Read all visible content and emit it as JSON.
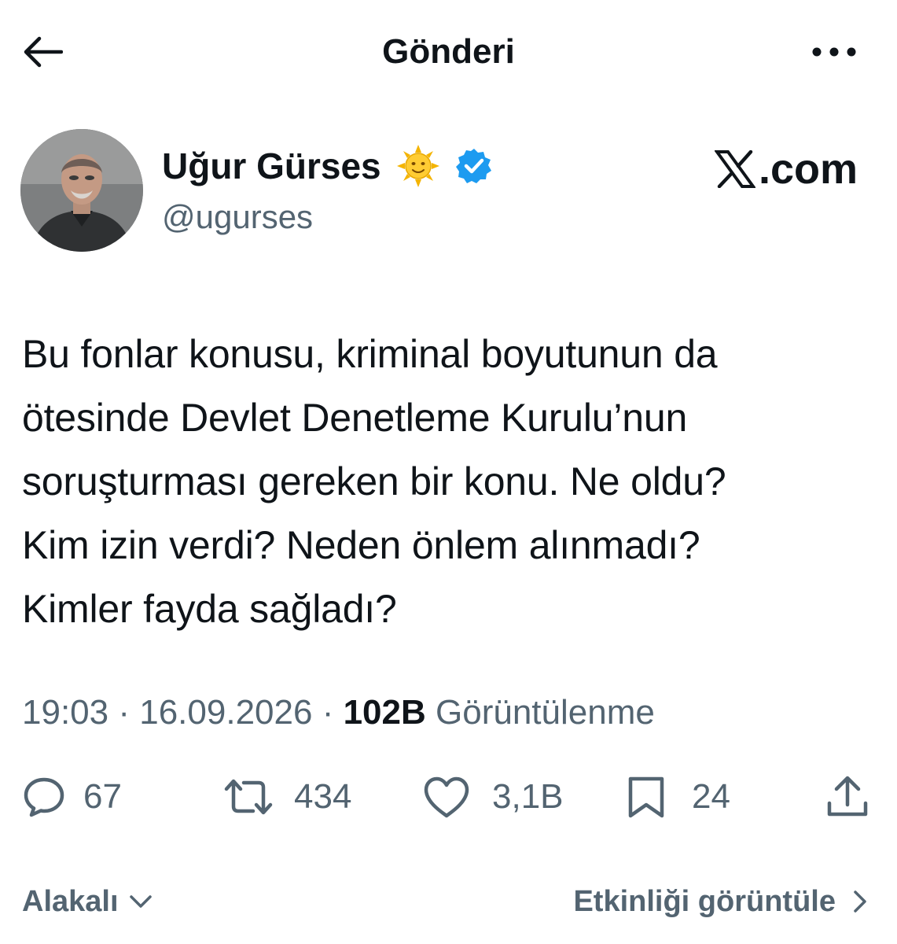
{
  "header": {
    "title": "Gönderi",
    "back_icon": "arrow-left-icon",
    "more_icon": "more-horizontal-icon"
  },
  "author": {
    "name": "Uğur Gürses",
    "handle": "@ugurses",
    "emoji": "sun-with-face-icon",
    "verified_icon": "verified-badge-icon",
    "verified_color": "#1d9bf0"
  },
  "brand": {
    "label": ".com",
    "icon": "x-logo-icon"
  },
  "post": {
    "text": "Bu fonlar konusu, kriminal boyutunun da\nötesinde Devlet Denetleme Kurulu’nun\nsoruşturması gereken bir konu. Ne oldu?\nKim izin verdi? Neden önlem alınmadı?\nKimler fayda sağladı?",
    "time": "19:03",
    "date": "16.09.2026",
    "separator": "·",
    "views_count": "102B",
    "views_label": "Görüntülenme"
  },
  "actions": {
    "replies": {
      "icon": "reply-icon",
      "count": "67"
    },
    "reposts": {
      "icon": "repost-icon",
      "count": "434"
    },
    "likes": {
      "icon": "heart-icon",
      "count": "3,1B"
    },
    "bookmarks": {
      "icon": "bookmark-icon",
      "count": "24"
    },
    "share": {
      "icon": "share-icon"
    }
  },
  "footer": {
    "related_label": "Alakalı",
    "activity_label": "Etkinliği görüntüle"
  },
  "colors": {
    "text": "#0f1419",
    "secondary": "#536471",
    "accent": "#1d9bf0",
    "background": "#ffffff"
  }
}
